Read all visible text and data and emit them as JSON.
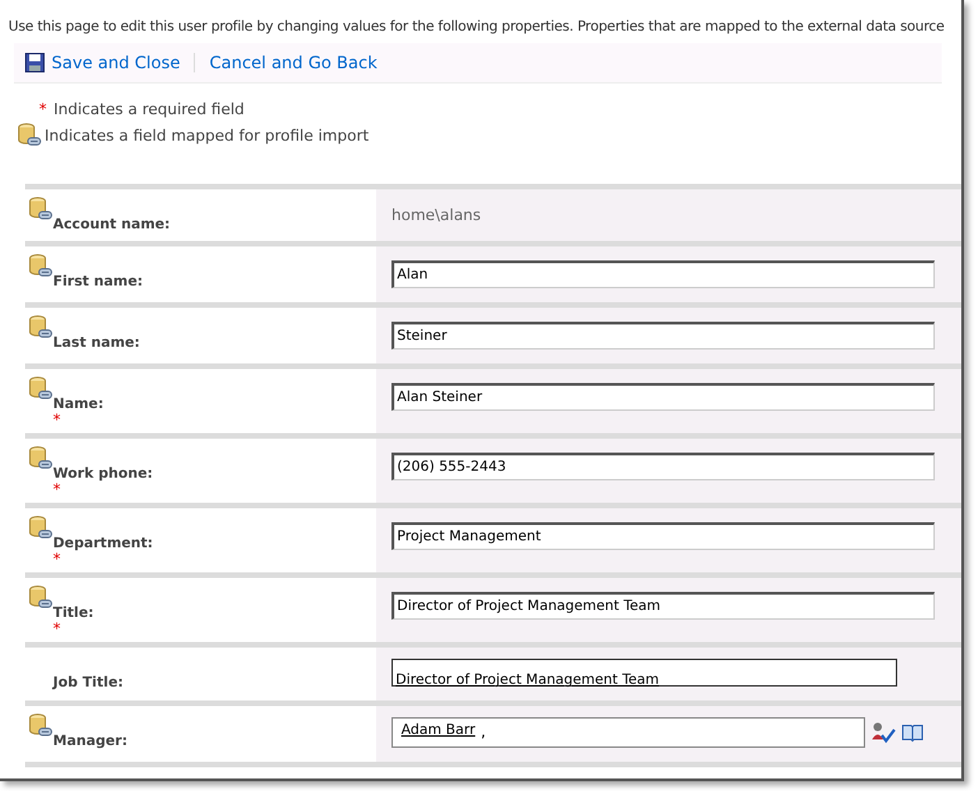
{
  "intro": "Use this page to edit this user profile by changing values for the following properties. Properties that are mapped to the external data source",
  "toolbar": [
    {
      "label": "Save and Close",
      "kind": "save"
    },
    {
      "label": "Cancel and Go Back",
      "kind": "cancel"
    }
  ],
  "legend": {
    "required_mark": "*",
    "required_text": "Indicates a required field",
    "mapped_text": "Indicates a field mapped for profile import"
  },
  "fields": [
    {
      "label": "Account name:",
      "mapped": true,
      "required": false,
      "kind": "static",
      "value": "home\\alans"
    },
    {
      "label": "First name:",
      "mapped": true,
      "required": false,
      "kind": "text",
      "value": "Alan"
    },
    {
      "label": "Last name:",
      "mapped": true,
      "required": false,
      "kind": "text",
      "value": "Steiner"
    },
    {
      "label": "Name:",
      "mapped": true,
      "required": true,
      "kind": "text",
      "value": "Alan Steiner"
    },
    {
      "label": "Work phone:",
      "mapped": true,
      "required": true,
      "kind": "text",
      "value": "(206) 555-2443"
    },
    {
      "label": "Department:",
      "mapped": true,
      "required": true,
      "kind": "text",
      "value": "Project Management"
    },
    {
      "label": "Title:",
      "mapped": true,
      "required": true,
      "kind": "text",
      "value": "Director of Project Management Team"
    },
    {
      "label": "Job Title:",
      "mapped": false,
      "required": false,
      "kind": "link",
      "value": "Director of Project Management Team"
    },
    {
      "label": "Manager:",
      "mapped": true,
      "required": false,
      "kind": "people",
      "value": "Adam Barr",
      "suffix": ","
    }
  ]
}
